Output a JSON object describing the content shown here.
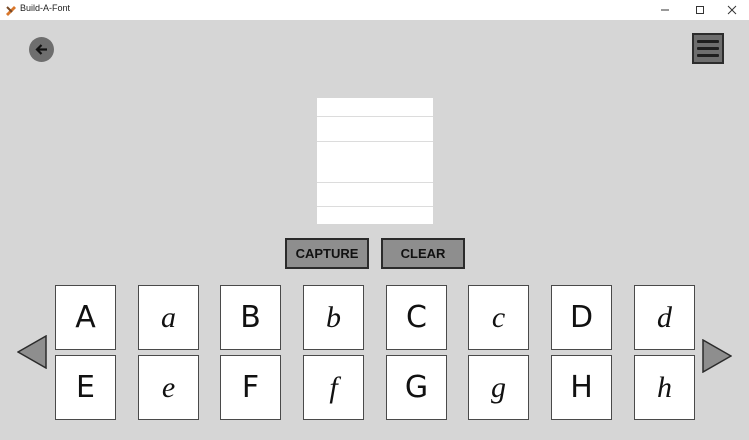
{
  "window": {
    "title": "Build-A-Font"
  },
  "actions": {
    "capture_label": "CAPTURE",
    "clear_label": "CLEAR"
  },
  "glyphs": {
    "row1": [
      "A",
      "a",
      "B",
      "b",
      "C",
      "c",
      "D",
      "d"
    ],
    "row2": [
      "E",
      "e",
      "F",
      "f",
      "G",
      "g",
      "H",
      "h"
    ]
  },
  "colors": {
    "background": "#d6d6d6",
    "button_fill": "#8e8e8e",
    "icon_fill": "#6e6e6e"
  },
  "icons": {
    "app": "build-a-font-icon",
    "back": "arrow-left-icon",
    "menu": "hamburger-menu-icon",
    "prev": "triangle-left-icon",
    "next": "triangle-right-icon"
  }
}
